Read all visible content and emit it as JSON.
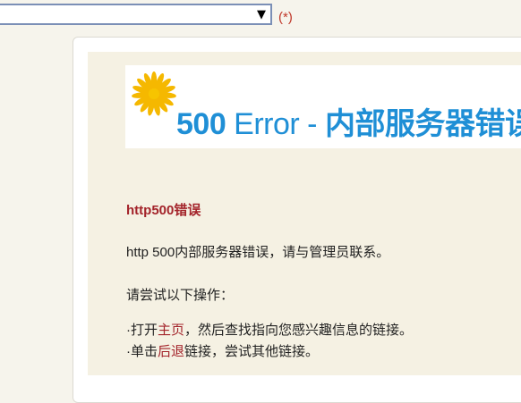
{
  "form": {
    "select_value": "",
    "required_mark": "(*)",
    "arrow_icon": "triangle-down"
  },
  "banner": {
    "code": "500",
    "title_en": " Error - ",
    "title_zh": "内部服务器错误",
    "logo_color": "#f5b800",
    "title_color": "#1f8fd6"
  },
  "error": {
    "heading": "http500错误",
    "description": "http 500内部服务器错误，请与管理员联系。",
    "try_label": "请尝试以下操作：",
    "action1": {
      "prefix": "·打开",
      "link": "主页",
      "suffix": "，然后查找指向您感兴趣信息的链接。"
    },
    "action2": {
      "prefix": "·单击",
      "link": "后退",
      "suffix": "链接，尝试其他链接。"
    },
    "accent_color": "#a3232a"
  }
}
